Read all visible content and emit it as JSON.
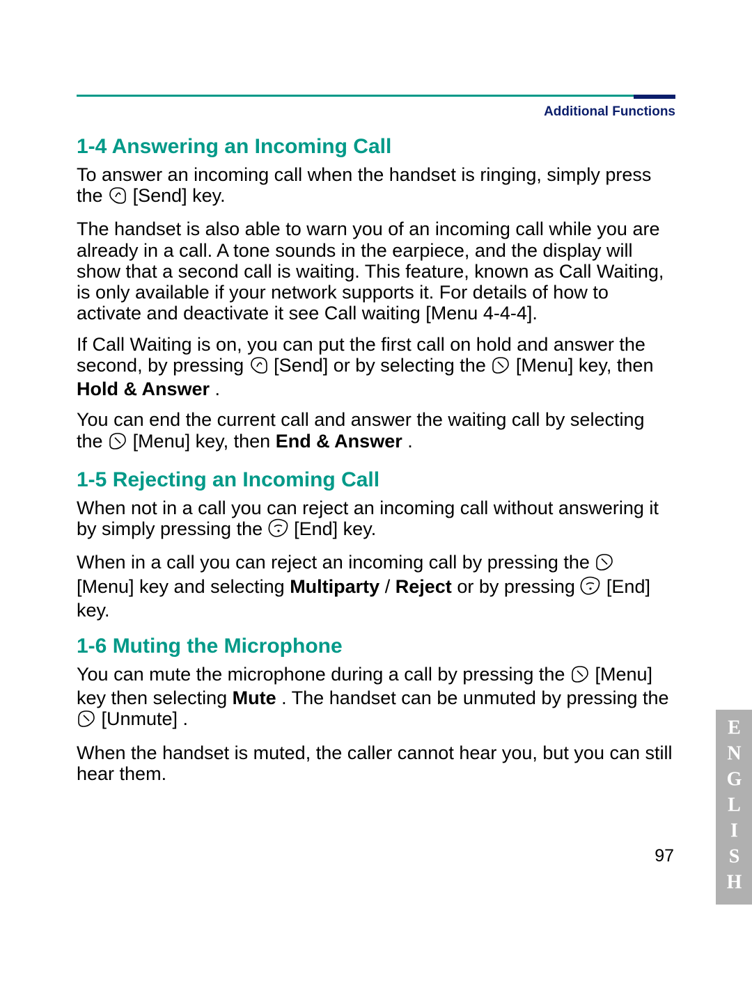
{
  "header": {
    "label": "Additional Functions"
  },
  "sections": {
    "s1": {
      "title": "1-4  Answering an Incoming Call",
      "p1a": "To answer an incoming call when the handset is ringing, simply press the ",
      "p1b": " [Send] key.",
      "p2": "The handset is also able to warn you of an incoming call while you are already in a call. A tone sounds in the earpiece, and the display will show that a second call is waiting. This feature, known as Call Waiting, is only available if your network supports it. For details of how to activate and deactivate it see Call waiting [Menu 4-4-4].",
      "p3a": "If Call Waiting is on, you can put the first call on hold and answer the second, by pressing  ",
      "p3b": "  [Send] or by selecting the ",
      "p3c": " [Menu] key, then ",
      "p3d": "Hold & Answer",
      "p3e": ".",
      "p4a": "You can end the current call and answer the waiting call by selecting the ",
      "p4b": " [Menu] key, then ",
      "p4c": "End & Answer",
      "p4d": "."
    },
    "s2": {
      "title": "1-5  Rejecting an Incoming Call",
      "p1a": "When not in a call you can reject an incoming call without answering it by simply pressing the  ",
      "p1b": "  [End] key.",
      "p2a": "When in a call you can reject an incoming call by pressing the ",
      "p2b": " [Menu] key and selecting ",
      "p2c": "Multiparty",
      "p2d": "/",
      "p2e": "Reject",
      "p2f": " or by pressing  ",
      "p2g": " [End] key."
    },
    "s3": {
      "title": "1-6  Muting the Microphone",
      "p1a": "You can mute the microphone during a call by pressing the ",
      "p1b": " [Menu] key then selecting ",
      "p1c": "Mute",
      "p1d": ". The handset can be unmuted by pressing the ",
      "p1e": " [Unmute] .",
      "p2": "When the handset is muted, the caller cannot hear you, but you can still hear them."
    }
  },
  "page_number": "97",
  "side_tab": "ENGLISH"
}
